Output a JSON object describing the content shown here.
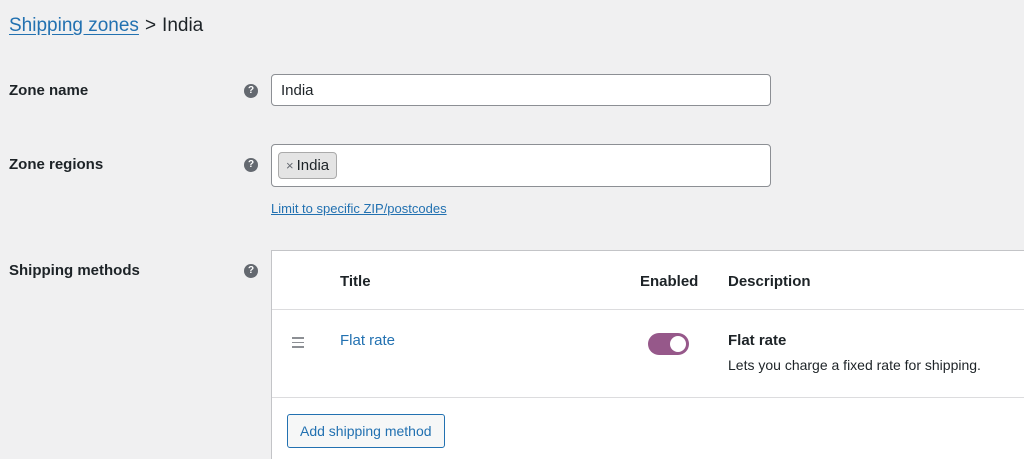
{
  "breadcrumb": {
    "parent_label": "Shipping zones",
    "separator": ">",
    "current": "India"
  },
  "zone_name": {
    "label": "Zone name",
    "help_icon": "question-circle-icon",
    "value": "India"
  },
  "zone_regions": {
    "label": "Zone regions",
    "help_icon": "question-circle-icon",
    "chips": [
      {
        "remove_glyph": "×",
        "label": "India"
      }
    ],
    "limit_link": "Limit to specific ZIP/postcodes"
  },
  "shipping_methods": {
    "label": "Shipping methods",
    "help_icon": "question-circle-icon",
    "columns": {
      "title": "Title",
      "enabled": "Enabled",
      "description": "Description"
    },
    "rows": [
      {
        "title": "Flat rate",
        "enabled": true,
        "description_title": "Flat rate",
        "description_text": "Lets you charge a fixed rate for shipping."
      }
    ],
    "add_button": "Add shipping method"
  },
  "colors": {
    "background": "#f0f0f1",
    "link": "#2271b1",
    "toggle_on": "#96588a",
    "text": "#1d2327"
  }
}
